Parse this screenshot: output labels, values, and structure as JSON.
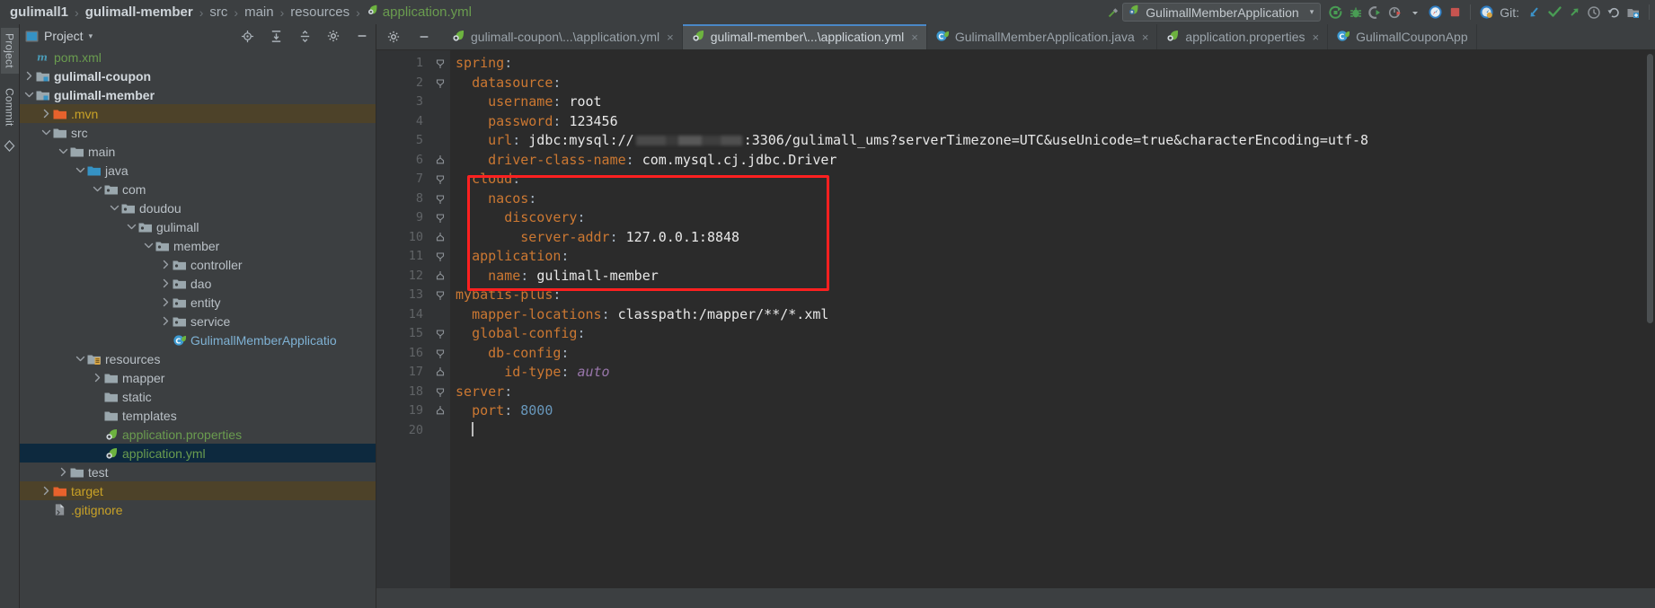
{
  "navbar": {
    "breadcrumb": [
      {
        "label": "gulimall1",
        "bold": true,
        "icon": null
      },
      {
        "label": "gulimall-member",
        "bold": true,
        "icon": null
      },
      {
        "label": "src",
        "bold": false,
        "icon": null
      },
      {
        "label": "main",
        "bold": false,
        "icon": null
      },
      {
        "label": "resources",
        "bold": false,
        "icon": null
      },
      {
        "label": "application.yml",
        "bold": false,
        "icon": "yml-file-icon"
      }
    ],
    "separator": "›",
    "run_config": {
      "label": "GulimallMemberApplication",
      "icon": "spring-boot-icon",
      "caret": "▾"
    },
    "toolbar_icons": [
      "build-hammer-icon",
      "run-icon",
      "debug-icon",
      "run-with-coverage-icon",
      "profiler-icon",
      "profiler-dropdown-icon",
      "search-everywhere-icon",
      "stop-icon",
      "settings-sync-icon"
    ],
    "git": {
      "label": "Git:",
      "icons": [
        "update-project-icon",
        "commit-icon",
        "push-icon",
        "history-icon",
        "rollback-icon",
        "branch-icon"
      ]
    }
  },
  "rail": {
    "tabs": [
      {
        "label": "Project",
        "active": true,
        "name": "rail-tab-project"
      },
      {
        "label": "Commit",
        "active": false,
        "name": "rail-tab-commit"
      }
    ],
    "icons": [
      "structure-icon",
      "favorites-icon"
    ]
  },
  "project_panel": {
    "title": "Project",
    "caret": "▾",
    "icon": "project-view-icon",
    "actions": [
      "locate-icon",
      "expand-all-icon",
      "collapse-all-icon",
      "settings-gear-icon",
      "hide-icon"
    ],
    "tree": [
      {
        "label": "pom.xml",
        "depth": 1,
        "arrow": "none",
        "icon": "maven-file-icon",
        "style": "green",
        "selected": false,
        "ignored": false
      },
      {
        "label": "gulimall-coupon",
        "depth": 1,
        "arrow": "collapsed",
        "icon": "module-folder-icon",
        "style": "bold",
        "selected": false,
        "ignored": false
      },
      {
        "label": "gulimall-member",
        "depth": 1,
        "arrow": "expanded",
        "icon": "module-folder-icon",
        "style": "bold",
        "selected": false,
        "ignored": false
      },
      {
        "label": ".mvn",
        "depth": 2,
        "arrow": "collapsed",
        "icon": "excluded-folder-icon",
        "style": "orange",
        "selected": false,
        "ignored": true
      },
      {
        "label": "src",
        "depth": 2,
        "arrow": "expanded",
        "icon": "folder-icon",
        "style": "plain",
        "selected": false,
        "ignored": false
      },
      {
        "label": "main",
        "depth": 3,
        "arrow": "expanded",
        "icon": "folder-icon",
        "style": "plain",
        "selected": false,
        "ignored": false
      },
      {
        "label": "java",
        "depth": 4,
        "arrow": "expanded",
        "icon": "source-root-icon",
        "style": "plain",
        "selected": false,
        "ignored": false
      },
      {
        "label": "com",
        "depth": 5,
        "arrow": "expanded",
        "icon": "package-icon",
        "style": "plain",
        "selected": false,
        "ignored": false
      },
      {
        "label": "doudou",
        "depth": 6,
        "arrow": "expanded",
        "icon": "package-icon",
        "style": "plain",
        "selected": false,
        "ignored": false
      },
      {
        "label": "gulimall",
        "depth": 7,
        "arrow": "expanded",
        "icon": "package-icon",
        "style": "plain",
        "selected": false,
        "ignored": false
      },
      {
        "label": "member",
        "depth": 8,
        "arrow": "expanded",
        "icon": "package-icon",
        "style": "plain",
        "selected": false,
        "ignored": false
      },
      {
        "label": "controller",
        "depth": 9,
        "arrow": "collapsed",
        "icon": "package-icon",
        "style": "plain",
        "selected": false,
        "ignored": false
      },
      {
        "label": "dao",
        "depth": 9,
        "arrow": "collapsed",
        "icon": "package-icon",
        "style": "plain",
        "selected": false,
        "ignored": false
      },
      {
        "label": "entity",
        "depth": 9,
        "arrow": "collapsed",
        "icon": "package-icon",
        "style": "plain",
        "selected": false,
        "ignored": false
      },
      {
        "label": "service",
        "depth": 9,
        "arrow": "collapsed",
        "icon": "package-icon",
        "style": "plain",
        "selected": false,
        "ignored": false
      },
      {
        "label": "GulimallMemberApplicatio",
        "depth": 9,
        "arrow": "none",
        "icon": "spring-class-icon",
        "style": "lightblue",
        "selected": false,
        "ignored": false
      },
      {
        "label": "resources",
        "depth": 4,
        "arrow": "expanded",
        "icon": "resource-root-icon",
        "style": "plain",
        "selected": false,
        "ignored": false
      },
      {
        "label": "mapper",
        "depth": 5,
        "arrow": "collapsed",
        "icon": "folder-icon",
        "style": "plain",
        "selected": false,
        "ignored": false
      },
      {
        "label": "static",
        "depth": 5,
        "arrow": "none",
        "icon": "folder-icon",
        "style": "plain",
        "selected": false,
        "ignored": false
      },
      {
        "label": "templates",
        "depth": 5,
        "arrow": "none",
        "icon": "folder-icon",
        "style": "plain",
        "selected": false,
        "ignored": false
      },
      {
        "label": "application.properties",
        "depth": 5,
        "arrow": "none",
        "icon": "spring-file-icon",
        "style": "greenfile",
        "selected": false,
        "ignored": false
      },
      {
        "label": "application.yml",
        "depth": 5,
        "arrow": "none",
        "icon": "spring-file-icon",
        "style": "greenfile",
        "selected": true,
        "ignored": false
      },
      {
        "label": "test",
        "depth": 3,
        "arrow": "collapsed",
        "icon": "folder-icon",
        "style": "plain",
        "selected": false,
        "ignored": false
      },
      {
        "label": "target",
        "depth": 2,
        "arrow": "collapsed",
        "icon": "excluded-folder-icon",
        "style": "orange",
        "selected": false,
        "ignored": true
      },
      {
        "label": ".gitignore",
        "depth": 2,
        "arrow": "none",
        "icon": "gitignore-file-icon",
        "style": "orange",
        "selected": false,
        "ignored": false
      }
    ]
  },
  "editor": {
    "tab_actions": [
      "settings-gear-icon",
      "hide-minimize-icon"
    ],
    "tabs": [
      {
        "label": "gulimall-coupon\\...\\application.yml",
        "icon": "spring-file-icon",
        "active": false,
        "close": "×"
      },
      {
        "label": "gulimall-member\\...\\application.yml",
        "icon": "spring-file-icon",
        "active": true,
        "close": "×"
      },
      {
        "label": "GulimallMemberApplication.java",
        "icon": "spring-class-icon",
        "active": false,
        "close": "×"
      },
      {
        "label": "application.properties",
        "icon": "spring-file-icon",
        "active": false,
        "close": "×"
      },
      {
        "label": "GulimallCouponApp",
        "icon": "spring-class-icon",
        "active": false,
        "close": ""
      }
    ],
    "line_numbers": [
      1,
      2,
      3,
      4,
      5,
      6,
      7,
      8,
      9,
      10,
      11,
      12,
      13,
      14,
      15,
      16,
      17,
      18,
      19,
      20
    ],
    "code": [
      {
        "n": 1,
        "indent": 0,
        "fold": "start",
        "tokens": [
          {
            "t": "spring",
            "c": "k"
          },
          {
            "t": ":",
            "c": "p"
          }
        ]
      },
      {
        "n": 2,
        "indent": 2,
        "fold": "start",
        "tokens": [
          {
            "t": "datasource",
            "c": "k"
          },
          {
            "t": ":",
            "c": "p"
          }
        ]
      },
      {
        "n": 3,
        "indent": 4,
        "fold": "none",
        "tokens": [
          {
            "t": "username",
            "c": "k"
          },
          {
            "t": ": ",
            "c": "p"
          },
          {
            "t": "root",
            "c": "v"
          }
        ]
      },
      {
        "n": 4,
        "indent": 4,
        "fold": "none",
        "tokens": [
          {
            "t": "password",
            "c": "k"
          },
          {
            "t": ": ",
            "c": "p"
          },
          {
            "t": "123456",
            "c": "v"
          }
        ]
      },
      {
        "n": 5,
        "indent": 4,
        "fold": "none",
        "tokens": [
          {
            "t": "url",
            "c": "k"
          },
          {
            "t": ": ",
            "c": "p"
          },
          {
            "t": "jdbc:mysql://",
            "c": "v"
          },
          {
            "t": "",
            "c": "redact"
          },
          {
            "t": ":3306/gulimall_ums?serverTimezone=UTC&useUnicode=true&characterEncoding=utf-8",
            "c": "v"
          }
        ]
      },
      {
        "n": 6,
        "indent": 4,
        "fold": "end",
        "tokens": [
          {
            "t": "driver-class-name",
            "c": "k"
          },
          {
            "t": ": ",
            "c": "p"
          },
          {
            "t": "com.mysql.cj.jdbc.Driver",
            "c": "v"
          }
        ]
      },
      {
        "n": 7,
        "indent": 2,
        "fold": "start",
        "tokens": [
          {
            "t": "cloud",
            "c": "k"
          },
          {
            "t": ":",
            "c": "p"
          }
        ]
      },
      {
        "n": 8,
        "indent": 4,
        "fold": "start",
        "tokens": [
          {
            "t": "nacos",
            "c": "k"
          },
          {
            "t": ":",
            "c": "p"
          }
        ]
      },
      {
        "n": 9,
        "indent": 6,
        "fold": "start",
        "tokens": [
          {
            "t": "discovery",
            "c": "k"
          },
          {
            "t": ":",
            "c": "p"
          }
        ]
      },
      {
        "n": 10,
        "indent": 8,
        "fold": "end",
        "tokens": [
          {
            "t": "server-addr",
            "c": "k"
          },
          {
            "t": ": ",
            "c": "p"
          },
          {
            "t": "127.0.0.1:8848",
            "c": "v"
          }
        ]
      },
      {
        "n": 11,
        "indent": 2,
        "fold": "start",
        "tokens": [
          {
            "t": "application",
            "c": "k"
          },
          {
            "t": ":",
            "c": "p"
          }
        ]
      },
      {
        "n": 12,
        "indent": 4,
        "fold": "end",
        "tokens": [
          {
            "t": "name",
            "c": "k"
          },
          {
            "t": ": ",
            "c": "p"
          },
          {
            "t": "gulimall-member",
            "c": "v"
          }
        ]
      },
      {
        "n": 13,
        "indent": 0,
        "fold": "start",
        "tokens": [
          {
            "t": "mybatis-plus",
            "c": "k"
          },
          {
            "t": ":",
            "c": "p"
          }
        ]
      },
      {
        "n": 14,
        "indent": 2,
        "fold": "none",
        "tokens": [
          {
            "t": "mapper-locations",
            "c": "k"
          },
          {
            "t": ": ",
            "c": "p"
          },
          {
            "t": "classpath:/mapper/**/*.xml",
            "c": "v"
          }
        ]
      },
      {
        "n": 15,
        "indent": 2,
        "fold": "start",
        "tokens": [
          {
            "t": "global-config",
            "c": "k"
          },
          {
            "t": ":",
            "c": "p"
          }
        ]
      },
      {
        "n": 16,
        "indent": 4,
        "fold": "start",
        "tokens": [
          {
            "t": "db-config",
            "c": "k"
          },
          {
            "t": ":",
            "c": "p"
          }
        ]
      },
      {
        "n": 17,
        "indent": 6,
        "fold": "end",
        "tokens": [
          {
            "t": "id-type",
            "c": "k"
          },
          {
            "t": ": ",
            "c": "p"
          },
          {
            "t": "auto",
            "c": "it"
          }
        ]
      },
      {
        "n": 18,
        "indent": 0,
        "fold": "start",
        "tokens": [
          {
            "t": "server",
            "c": "k"
          },
          {
            "t": ":",
            "c": "p"
          }
        ]
      },
      {
        "n": 19,
        "indent": 2,
        "fold": "end",
        "tokens": [
          {
            "t": "port",
            "c": "k"
          },
          {
            "t": ": ",
            "c": "p"
          },
          {
            "t": "8000",
            "c": "num"
          }
        ]
      },
      {
        "n": 20,
        "indent": 2,
        "fold": "none",
        "tokens": [
          {
            "t": "",
            "c": "caret"
          }
        ]
      }
    ],
    "annotation": {
      "type": "red-rectangle",
      "color": "#ff2020",
      "covers_lines": [
        7,
        12
      ],
      "label": ""
    }
  },
  "colors": {
    "background": "#3c3f41",
    "editor_bg": "#2b2b2b",
    "gutter_bg": "#313335",
    "key": "#cc7832",
    "value": "#e8e8e8",
    "number": "#6897bb",
    "italic_value": "#9876aa",
    "selection": "#0d293e",
    "ignored_row": "#4d4229",
    "accent": "#4a88c7",
    "annotation": "#ff2020"
  }
}
